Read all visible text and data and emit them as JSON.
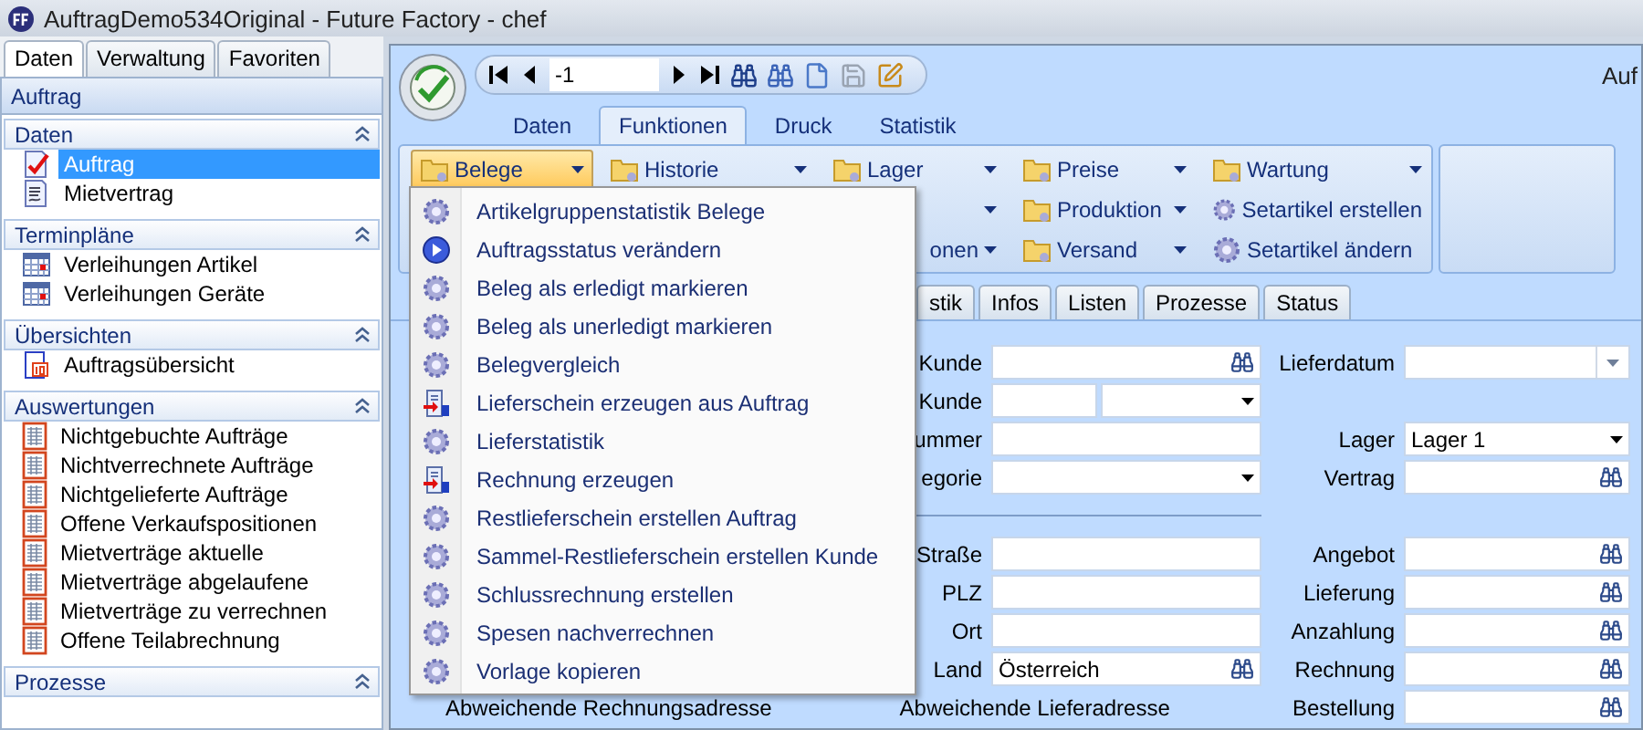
{
  "window": {
    "title": "AuftragDemo534Original - Future Factory - chef"
  },
  "sidebar": {
    "tabs": [
      {
        "label": "Daten",
        "selected": true
      },
      {
        "label": "Verwaltung",
        "selected": false
      },
      {
        "label": "Favoriten",
        "selected": false
      }
    ],
    "header": "Auftrag",
    "groups": [
      {
        "title": "Daten",
        "expanded": true,
        "items": [
          {
            "label": "Auftrag",
            "kind": "checked-doc",
            "selected": true
          },
          {
            "label": "Mietvertrag",
            "kind": "contract",
            "selected": false
          }
        ]
      },
      {
        "title": "Terminpläne",
        "expanded": true,
        "items": [
          {
            "label": "Verleihungen Artikel",
            "kind": "calendar",
            "selected": false
          },
          {
            "label": "Verleihungen Geräte",
            "kind": "calendar",
            "selected": false
          }
        ]
      },
      {
        "title": "Übersichten",
        "expanded": true,
        "items": [
          {
            "label": "Auftragsübersicht",
            "kind": "overview",
            "selected": false
          }
        ]
      },
      {
        "title": "Auswertungen",
        "expanded": true,
        "items": [
          {
            "label": "Nichtgebuchte Aufträge",
            "kind": "report",
            "selected": false
          },
          {
            "label": "Nichtverrechnete Aufträge",
            "kind": "report",
            "selected": false
          },
          {
            "label": "Nichtgelieferte Aufträge",
            "kind": "report",
            "selected": false
          },
          {
            "label": "Offene Verkaufspositionen",
            "kind": "report",
            "selected": false
          },
          {
            "label": "Mietverträge aktuelle",
            "kind": "report",
            "selected": false
          },
          {
            "label": "Mietverträge abgelaufene",
            "kind": "report",
            "selected": false
          },
          {
            "label": "Mietverträge zu verrechnen",
            "kind": "report",
            "selected": false
          },
          {
            "label": "Offene Teilabrechnung",
            "kind": "report",
            "selected": false
          }
        ]
      },
      {
        "title": "Prozesse",
        "expanded": true
      }
    ]
  },
  "toolbar": {
    "record": "-1",
    "caption": "Auf"
  },
  "ribbon": {
    "tabs": [
      {
        "label": "Daten",
        "selected": false
      },
      {
        "label": "Funktionen",
        "selected": true
      },
      {
        "label": "Druck",
        "selected": false
      },
      {
        "label": "Statistik",
        "selected": false
      }
    ],
    "columns": [
      [
        {
          "label": "Belege",
          "kind": "folder",
          "dropdown": true,
          "expanded": true
        }
      ],
      [
        {
          "label": "Historie",
          "kind": "folder",
          "dropdown": true,
          "expanded": false
        }
      ],
      [
        {
          "label": "Lager",
          "kind": "folder",
          "dropdown": true,
          "expanded": false
        },
        {
          "kind": "clipped",
          "dropdown": true,
          "expanded": false
        },
        {
          "label": "onen",
          "kind": "clipped",
          "dropdown": true,
          "expanded": false
        }
      ],
      [
        {
          "label": "Preise",
          "kind": "folder",
          "dropdown": true,
          "expanded": false
        },
        {
          "label": "Produktion",
          "kind": "folder",
          "dropdown": true,
          "expanded": false
        },
        {
          "label": "Versand",
          "kind": "folder",
          "dropdown": true,
          "expanded": false
        }
      ],
      [
        {
          "label": "Wartung",
          "kind": "folder",
          "dropdown": true,
          "expanded": false
        },
        {
          "label": "Setartikel erstellen",
          "kind": "gear",
          "dropdown": false,
          "expanded": false
        },
        {
          "label": "Setartikel ändern",
          "kind": "gear",
          "dropdown": false,
          "expanded": false
        }
      ]
    ]
  },
  "menu": {
    "items": [
      {
        "label": "Artikelgruppenstatistik Belege",
        "kind": "gear"
      },
      {
        "label": "Auftragsstatus verändern",
        "kind": "play"
      },
      {
        "label": "Beleg als erledigt markieren",
        "kind": "gear"
      },
      {
        "label": "Beleg als unerledigt markieren",
        "kind": "gear"
      },
      {
        "label": "Belegvergleich",
        "kind": "gear"
      },
      {
        "label": "Lieferschein erzeugen aus Auftrag",
        "kind": "doc-arrow"
      },
      {
        "label": "Lieferstatistik",
        "kind": "gear"
      },
      {
        "label": "Rechnung erzeugen",
        "kind": "doc-arrow"
      },
      {
        "label": "Restlieferschein erstellen Auftrag",
        "kind": "gear"
      },
      {
        "label": "Sammel-Restlieferschein erstellen Kunde",
        "kind": "gear"
      },
      {
        "label": "Schlussrechnung erstellen",
        "kind": "gear"
      },
      {
        "label": "Spesen nachverrechnen",
        "kind": "gear"
      },
      {
        "label": "Vorlage kopieren",
        "kind": "gear"
      }
    ]
  },
  "doc_tabs": [
    {
      "label": "stik",
      "selected": false
    },
    {
      "label": "Infos",
      "selected": false
    },
    {
      "label": "Listen",
      "selected": false
    },
    {
      "label": "Prozesse",
      "selected": false
    },
    {
      "label": "Status",
      "selected": false
    }
  ],
  "form": {
    "rows": [
      {
        "left": {
          "label": "Kunde",
          "field": {
            "kind": "lookup"
          }
        },
        "right": {
          "label": "Lieferdatum",
          "field": {
            "kind": "date"
          }
        }
      },
      {
        "left": {
          "label": "Kunde",
          "field": {
            "kind": "split"
          }
        }
      },
      {
        "left": {
          "label": "ummer",
          "field": {
            "kind": "text"
          }
        },
        "right": {
          "label": "Lager",
          "field": {
            "kind": "dropdown",
            "value": "Lager 1"
          }
        }
      },
      {
        "left": {
          "label": "egorie",
          "field": {
            "kind": "dropdown"
          }
        },
        "right": {
          "label": "Vertrag",
          "field": {
            "kind": "lookup"
          }
        }
      }
    ],
    "address_rows": [
      {
        "left": {
          "label": "Straße",
          "field": {
            "kind": "text"
          }
        },
        "right": {
          "label": "Angebot",
          "field": {
            "kind": "lookup"
          }
        }
      },
      {
        "left": {
          "label": "PLZ",
          "field": {
            "kind": "text"
          }
        },
        "right": {
          "label": "Lieferung",
          "field": {
            "kind": "lookup"
          }
        }
      },
      {
        "left": {
          "label": "Ort",
          "field": {
            "kind": "text"
          }
        },
        "right": {
          "label": "Anzahlung",
          "field": {
            "kind": "lookup"
          }
        }
      },
      {
        "left": {
          "label": "Land",
          "field": {
            "kind": "lookup",
            "value": "Österreich"
          }
        },
        "right": {
          "label": "Rechnung",
          "field": {
            "kind": "lookup"
          }
        }
      }
    ],
    "footer": {
      "left_heading": "Abweichende Rechnungsadresse",
      "middle_heading": "Abweichende Lieferadresse",
      "right": {
        "label": "Bestellung",
        "field": {
          "kind": "lookup"
        }
      }
    }
  }
}
